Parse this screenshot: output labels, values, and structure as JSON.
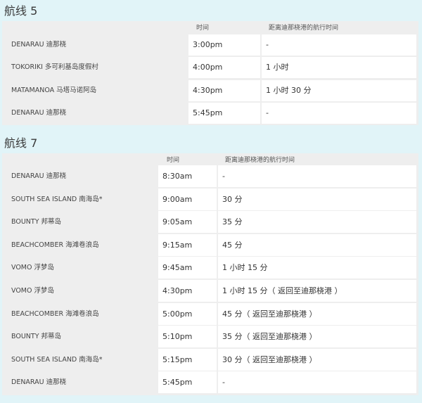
{
  "route5": {
    "title": "航线 5",
    "time_header": "时间",
    "duration_header": "距离迪那桡港的航行时间",
    "rows": [
      {
        "place": "DENARAU 迪那桡",
        "time": "3:00pm",
        "duration": "-"
      },
      {
        "place": "TOKORIKI 多可利基岛度假村",
        "time": "4:00pm",
        "duration": "1 小时"
      },
      {
        "place": "MATAMANOA 马塔马诺阿岛",
        "time": "4:30pm",
        "duration": "1 小时 30 分"
      },
      {
        "place": "DENARAU 迪那桡",
        "time": "5:45pm",
        "duration": "-"
      }
    ]
  },
  "route7": {
    "title": "航线 7",
    "time_header": "时间",
    "duration_header": "距离迪那桡港的航行时间",
    "rows": [
      {
        "place": "DENARAU 迪那桡",
        "time": "8:30am",
        "duration": "-"
      },
      {
        "place": "SOUTH SEA ISLAND 南海岛*",
        "time": "9:00am",
        "duration": "30 分"
      },
      {
        "place": "BOUNTY 邦蒂岛",
        "time": "9:05am",
        "duration": "35 分"
      },
      {
        "place": "BEACHCOMBER 海滩卷浪岛",
        "time": "9:15am",
        "duration": "45 分"
      },
      {
        "place": "VOMO 浮梦岛",
        "time": "9:45am",
        "duration": "1 小时 15 分"
      },
      {
        "place": "VOMO 浮梦岛",
        "time": "4:30pm",
        "duration": "1 小时 15 分（ 返回至迪那桡港 ）"
      },
      {
        "place": "BEACHCOMBER 海滩卷浪岛",
        "time": "5:00pm",
        "duration": "45 分（ 返回至迪那桡港 ）"
      },
      {
        "place": "BOUNTY 邦蒂岛",
        "time": "5:10pm",
        "duration": "35 分（ 返回至迪那桡港 ）"
      },
      {
        "place": "SOUTH SEA ISLAND 南海岛*",
        "time": "5:15pm",
        "duration": "30 分（ 返回至迪那桡港 ）"
      },
      {
        "place": "DENARAU 迪那桡",
        "time": "5:45pm",
        "duration": "-"
      }
    ]
  }
}
